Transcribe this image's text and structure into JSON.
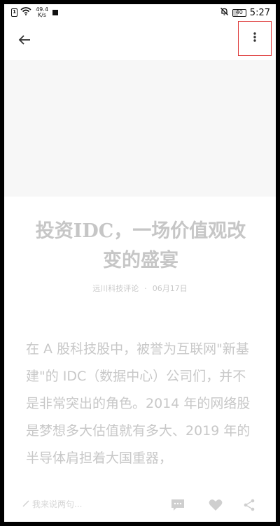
{
  "status_bar": {
    "sim_label": "1",
    "net_speed_value": "49.4",
    "net_speed_unit": "K/s",
    "battery": "40",
    "time": "5:27"
  },
  "article": {
    "title": "投资IDC，一场价值观改变的盛宴",
    "source": "远川科技评论",
    "date": "06月17日",
    "body": "在 A 股科技股中，被誉为互联网\"新基建\"的 IDC（数据中心）公司们，并不是非常突出的角色。2014 年的网络股是梦想多大估值就有多大、2019 年的半导体肩担着大国重器，"
  },
  "bottom_bar": {
    "comment_placeholder": "我来说两句..."
  },
  "icons": [
    "back-arrow-icon",
    "more-vertical-icon",
    "comment-icon",
    "heart-icon",
    "share-icon",
    "pencil-icon",
    "wifi-icon",
    "mute-bell-icon"
  ],
  "colors": {
    "highlight_border": "#dd3333",
    "faded_text": "#c8c8c8"
  }
}
